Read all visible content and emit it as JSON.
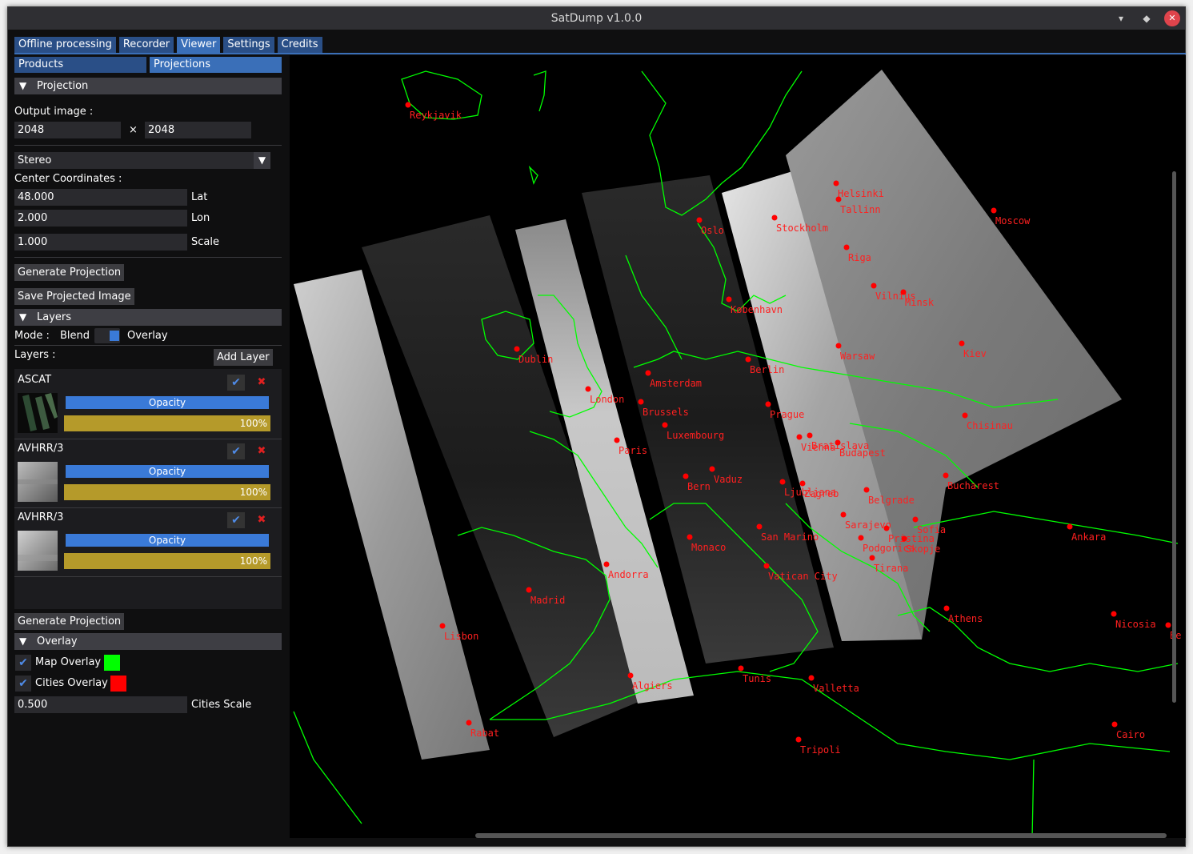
{
  "window": {
    "title": "SatDump v1.0.0",
    "min_icon": "minimize-icon",
    "max_icon": "maximize-icon",
    "close_icon": "close-icon"
  },
  "tabs": [
    "Offline processing",
    "Recorder",
    "Viewer",
    "Settings",
    "Credits"
  ],
  "subtabs": [
    "Products",
    "Projections"
  ],
  "projection": {
    "header": "Projection",
    "output_label": "Output image :",
    "width": "2048",
    "times": "×",
    "height": "2048",
    "type": "Stereo",
    "center_label": "Center Coordinates :",
    "lat": "48.000",
    "lat_label": "Lat",
    "lon": "2.000",
    "lon_label": "Lon",
    "scale": "1.000",
    "scale_label": "Scale",
    "generate_label": "Generate Projection",
    "save_label": "Save Projected Image"
  },
  "layers": {
    "header": "Layers",
    "mode_label": "Mode :",
    "blend_label": "Blend",
    "overlay_label": "Overlay",
    "layers_label": "Layers :",
    "add_label": "Add Layer",
    "items": [
      {
        "name": "ASCAT",
        "opacity_label": "Opacity",
        "value": "100%"
      },
      {
        "name": "AVHRR/3",
        "opacity_label": "Opacity",
        "value": "100%"
      },
      {
        "name": "AVHRR/3",
        "opacity_label": "Opacity",
        "value": "100%"
      }
    ],
    "generate_label": "Generate Projection"
  },
  "overlay": {
    "header": "Overlay",
    "map_label": "Map Overlay",
    "map_color": "#00ff00",
    "cities_label": "Cities Overlay",
    "cities_color": "#ff0000",
    "cities_scale": "0.500",
    "cities_scale_label": "Cities Scale"
  },
  "cities": [
    "Reykjavik",
    "Oslo",
    "Stockholm",
    "Helsinki",
    "Tallinn",
    "Moscow",
    "Riga",
    "Vilnius",
    "Minsk",
    "København",
    "Dublin",
    "Berlin",
    "Warsaw",
    "Kiev",
    "Amsterdam",
    "London",
    "Brussels",
    "Prague",
    "Chisinau",
    "Luxembourg",
    "Paris",
    "Vienna",
    "Bratislava",
    "Budapest",
    "Bern",
    "Vaduz",
    "Ljubljana",
    "Zagreb",
    "Belgrade",
    "Bucharest",
    "Sarajevo",
    "Sofia",
    "Ankara",
    "Monaco",
    "San Marino",
    "Pristina",
    "Podgorica",
    "Skopje",
    "Andorra",
    "Tirana",
    "Vatican City",
    "Madrid",
    "Athens",
    "Nicosia",
    "Lisbon",
    "Algiers",
    "Tunis",
    "Valletta",
    "Rabat",
    "Tripoli",
    "Cairo",
    "Be"
  ]
}
